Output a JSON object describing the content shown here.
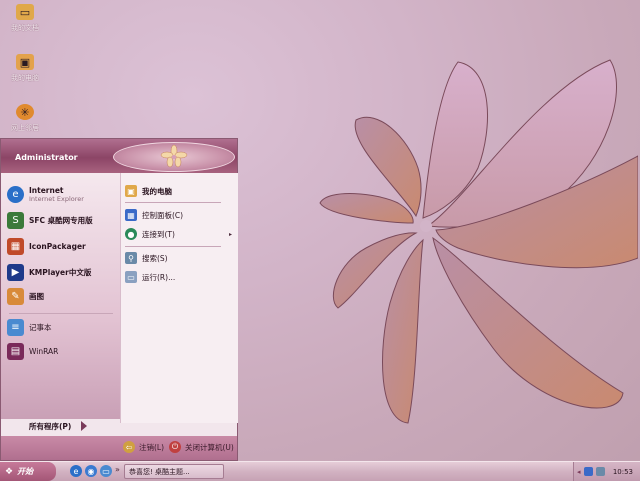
{
  "desktop": {
    "icons": [
      {
        "label": "我的文档",
        "icon": "folder-icon"
      },
      {
        "label": "我的电脑",
        "icon": "computer-icon"
      },
      {
        "label": "网上邻居",
        "icon": "network-icon"
      }
    ]
  },
  "start_menu": {
    "user": "Administrator",
    "programs": [
      {
        "title": "Internet",
        "subtitle": "Internet Explorer",
        "icon": "internet-explorer-icon"
      },
      {
        "title": "SFC 桌酷网专用版",
        "icon": "sfc-icon"
      },
      {
        "title": "IconPackager",
        "icon": "iconpackager-icon"
      },
      {
        "title": "KMPlayer中文版",
        "icon": "kmplayer-icon"
      },
      {
        "title": "画图",
        "icon": "paint-icon"
      },
      {
        "title": "记事本",
        "icon": "notepad-icon"
      },
      {
        "title": "WinRAR",
        "icon": "winrar-icon"
      }
    ],
    "all_programs": "所有程序(P)",
    "places": [
      {
        "label": "我的电脑",
        "icon": "my-computer-icon"
      },
      {
        "label": "控制面板(C)",
        "icon": "control-panel-icon"
      },
      {
        "label": "连接到(T)",
        "icon": "connect-icon"
      },
      {
        "label": "搜索(S)",
        "icon": "search-icon"
      },
      {
        "label": "运行(R)...",
        "icon": "run-icon"
      }
    ],
    "logoff": "注销(L)",
    "shutdown": "关闭计算机(U)"
  },
  "taskbar": {
    "start_label": "开始",
    "tasks": [
      {
        "label": "恭喜您! 桌酷主题..."
      }
    ],
    "clock": "10:53"
  },
  "colors": {
    "accent": "#a35676",
    "desktop": "#d2b4c8"
  }
}
